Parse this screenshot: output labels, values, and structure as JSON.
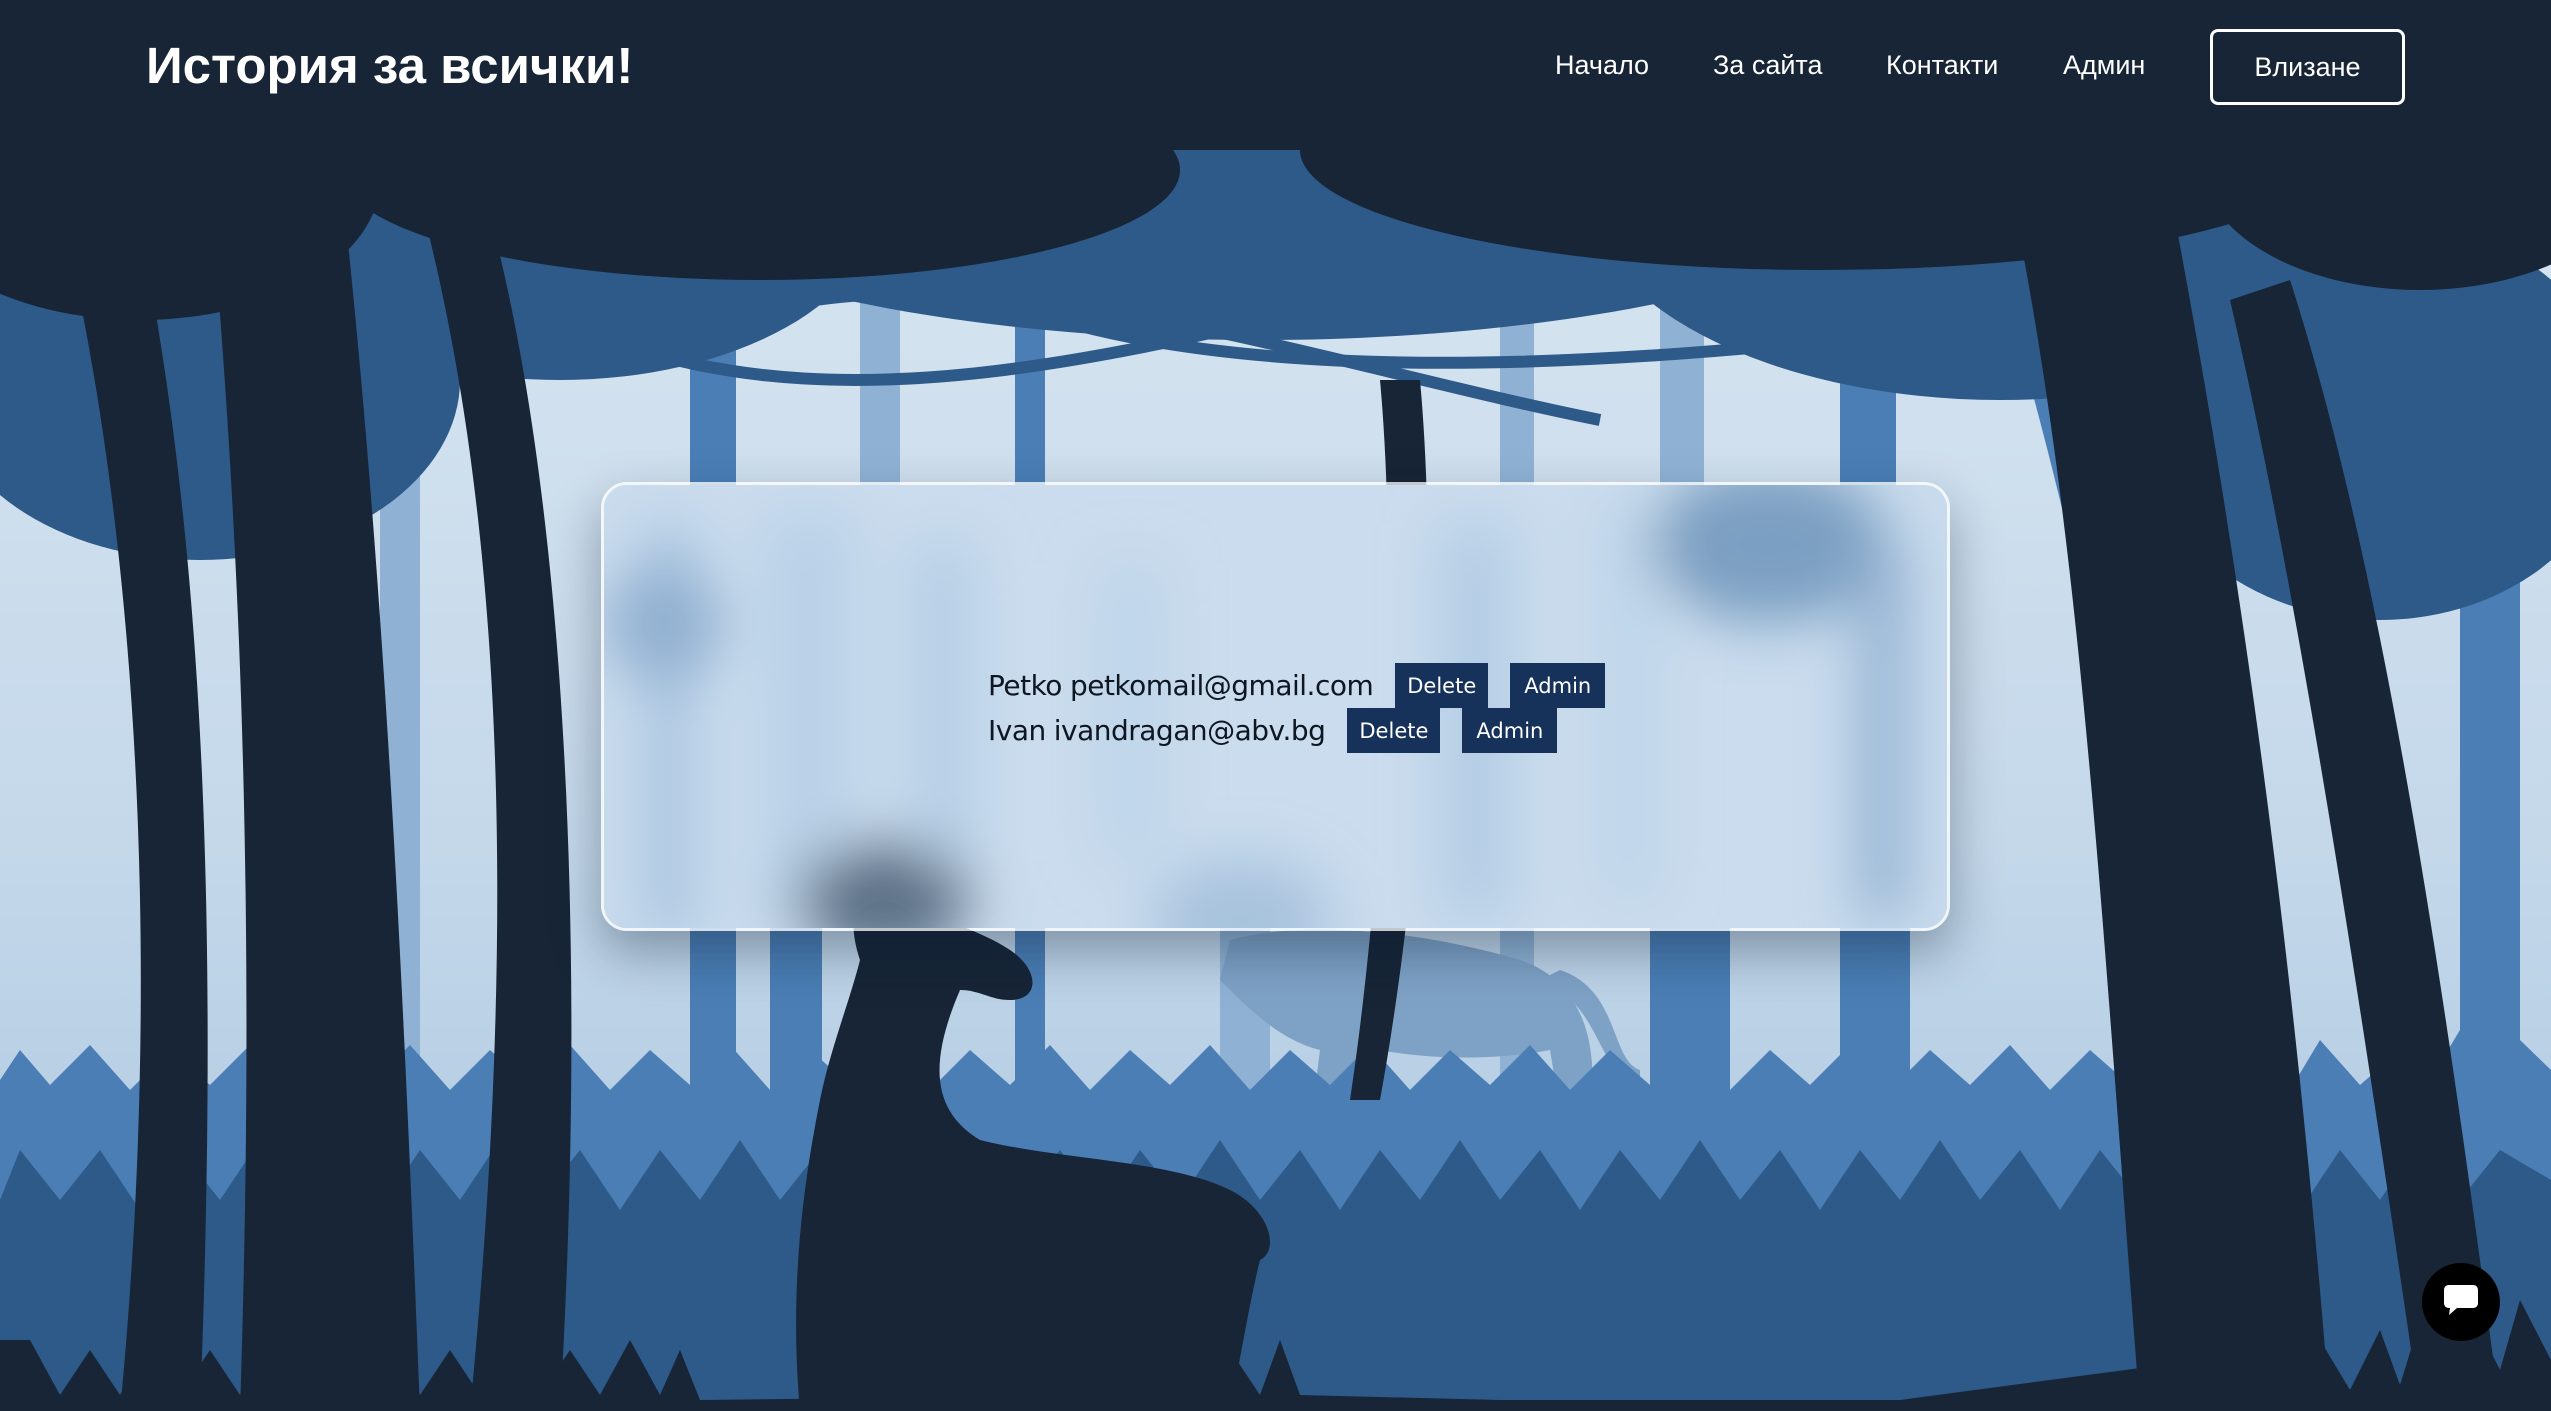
{
  "header": {
    "brand": "История за всички!",
    "nav": [
      {
        "label": "Начало"
      },
      {
        "label": "За сайта"
      },
      {
        "label": "Контакти"
      },
      {
        "label": "Админ"
      }
    ],
    "login_label": "Влизане"
  },
  "users": [
    {
      "name": "Petko",
      "email": "petkomail@gmail.com",
      "delete_label": "Delete",
      "admin_label": "Admin"
    },
    {
      "name": "Ivan",
      "email": "ivandragan@abv.bg",
      "delete_label": "Delete",
      "admin_label": "Admin"
    }
  ],
  "chat": {
    "icon": "chat-bubble-icon"
  },
  "colors": {
    "sky": "#c7dbeb",
    "dark_tree": "#172537",
    "mid_tree": "#2d5a88",
    "light_tree": "#4a7eb5",
    "button_bg": "#16325b",
    "header_text": "#ffffff"
  }
}
